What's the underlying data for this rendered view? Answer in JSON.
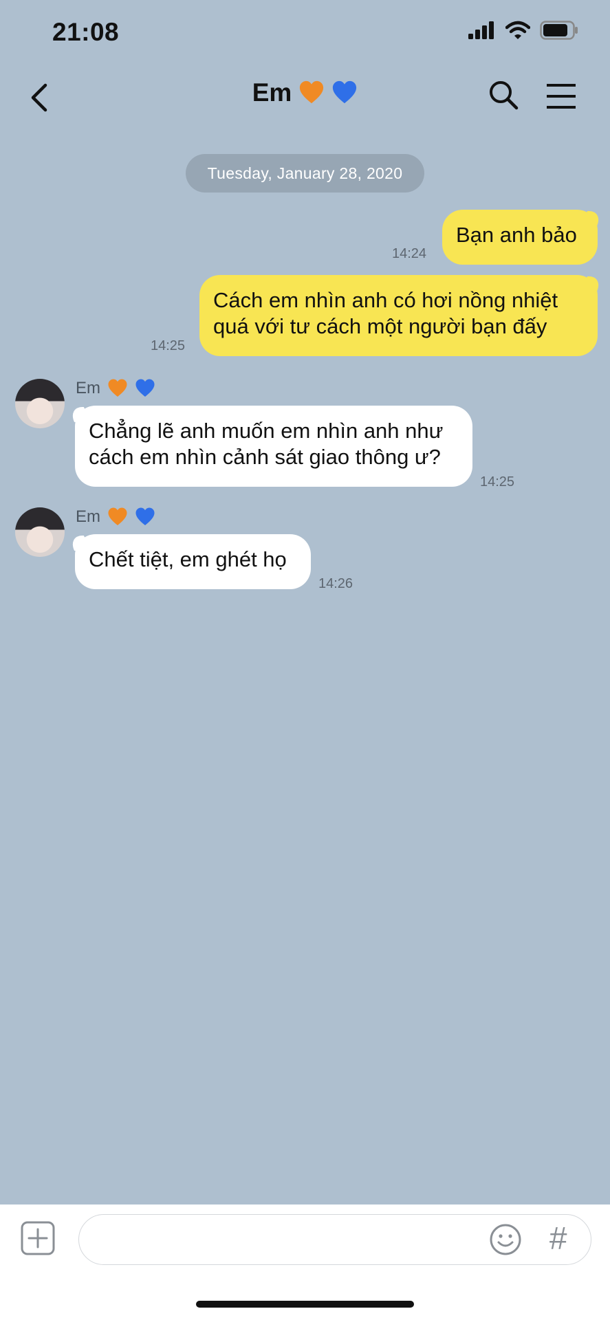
{
  "status_bar": {
    "time": "21:08"
  },
  "header": {
    "title": "Em",
    "title_emojis": [
      "orange-heart",
      "blue-heart"
    ]
  },
  "date_separator": "Tuesday, January 28, 2020",
  "messages": [
    {
      "direction": "out",
      "lines": [
        "Bạn anh bảo"
      ],
      "time": "14:24"
    },
    {
      "direction": "out",
      "lines": [
        "Cách em nhìn anh có hơi nồng nhiệt",
        "quá với tư cách một người bạn đấy"
      ],
      "time": "14:25"
    },
    {
      "direction": "in",
      "sender": "Em",
      "lines": [
        "Chẳng lẽ anh muốn em nhìn anh như",
        "cách em nhìn cảnh sát giao thông ư?"
      ],
      "time": "14:25"
    },
    {
      "direction": "in",
      "sender": "Em",
      "lines": [
        "Chết tiệt, em ghét họ"
      ],
      "time": "14:26"
    }
  ],
  "composer": {
    "value": "",
    "hash_label": "#"
  },
  "colors": {
    "background": "#aebfcf",
    "outgoing_bubble": "#f8e553",
    "incoming_bubble": "#ffffff",
    "date_pill": "#97a6b4"
  }
}
